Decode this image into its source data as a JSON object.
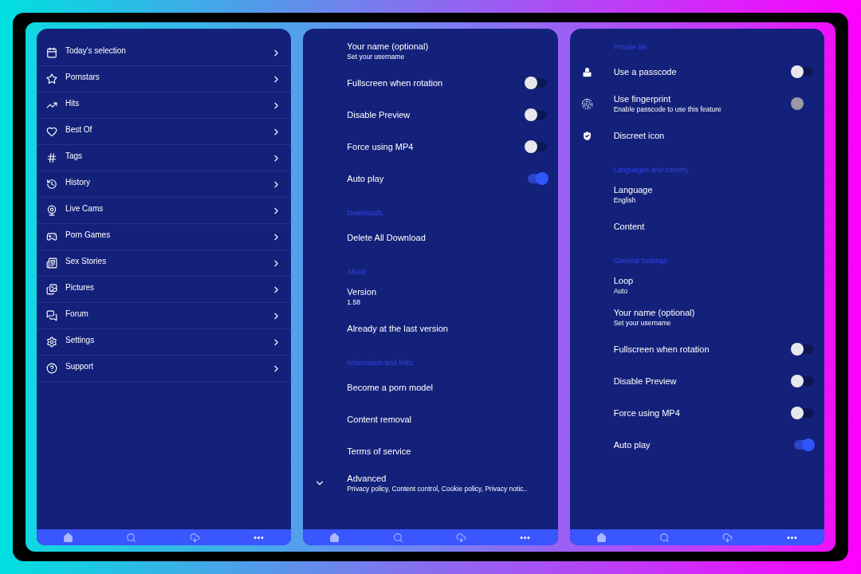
{
  "screens": [
    {
      "kind": "menu",
      "items": [
        {
          "label": "Today's selection"
        },
        {
          "label": "Pornstars"
        },
        {
          "label": "Hits"
        },
        {
          "label": "Best Of"
        },
        {
          "label": "Tags"
        },
        {
          "label": "History"
        },
        {
          "label": "Live Cams"
        },
        {
          "label": "Porn Games"
        },
        {
          "label": "Sex Stories"
        },
        {
          "label": "Pictures"
        },
        {
          "label": "Forum"
        },
        {
          "label": "Settings"
        },
        {
          "label": "Support"
        }
      ]
    },
    {
      "kind": "settings",
      "rows": [
        {
          "kind": "item",
          "title": "Your name (optional)",
          "subtitle": "Set your username"
        },
        {
          "kind": "toggle",
          "title": "Fullscreen when rotation",
          "on": false,
          "disabled": false
        },
        {
          "kind": "toggle",
          "title": "Disable Preview",
          "on": false,
          "disabled": false
        },
        {
          "kind": "toggle",
          "title": "Force using MP4",
          "on": false,
          "disabled": false
        },
        {
          "kind": "toggle",
          "title": "Auto play",
          "on": true,
          "disabled": false
        },
        {
          "kind": "header",
          "title": "Downloads"
        },
        {
          "kind": "item",
          "title": "Delete All Download"
        },
        {
          "kind": "header",
          "title": "About"
        },
        {
          "kind": "item",
          "title": "Version",
          "subtitle": "1.58"
        },
        {
          "kind": "item",
          "title": "Already at the last version"
        },
        {
          "kind": "header",
          "title": "Information and links"
        },
        {
          "kind": "item",
          "title": "Become a porn model"
        },
        {
          "kind": "item",
          "title": "Content removal"
        },
        {
          "kind": "item",
          "title": "Terms of service"
        },
        {
          "kind": "expand",
          "title": "Advanced",
          "subtitle": "Privacy policy, Content control, Cookie policy, Privacy notic..",
          "expanded": false
        }
      ]
    },
    {
      "kind": "settings",
      "rows": [
        {
          "kind": "header",
          "title": "Private life"
        },
        {
          "kind": "toggle",
          "title": "Use a passcode",
          "on": false,
          "disabled": false
        },
        {
          "kind": "toggle",
          "title": "Use fingerprint",
          "subtitle": "Enable passcode to use this feature",
          "on": false,
          "disabled": true
        },
        {
          "kind": "item",
          "title": "Discreet icon"
        },
        {
          "kind": "header",
          "title": "Languages and country"
        },
        {
          "kind": "item",
          "title": "Language",
          "subtitle": "English"
        },
        {
          "kind": "item",
          "title": "Content"
        },
        {
          "kind": "header",
          "title": "General Settings"
        },
        {
          "kind": "item",
          "title": "Loop",
          "subtitle": "Auto"
        },
        {
          "kind": "item",
          "title": "Your name (optional)",
          "subtitle": "Set your username"
        },
        {
          "kind": "toggle",
          "title": "Fullscreen when rotation",
          "on": false,
          "disabled": false
        },
        {
          "kind": "toggle",
          "title": "Disable Preview",
          "on": false,
          "disabled": false
        },
        {
          "kind": "toggle",
          "title": "Force using MP4",
          "on": false,
          "disabled": false
        },
        {
          "kind": "toggle",
          "title": "Auto play",
          "on": true,
          "disabled": false
        }
      ]
    }
  ]
}
